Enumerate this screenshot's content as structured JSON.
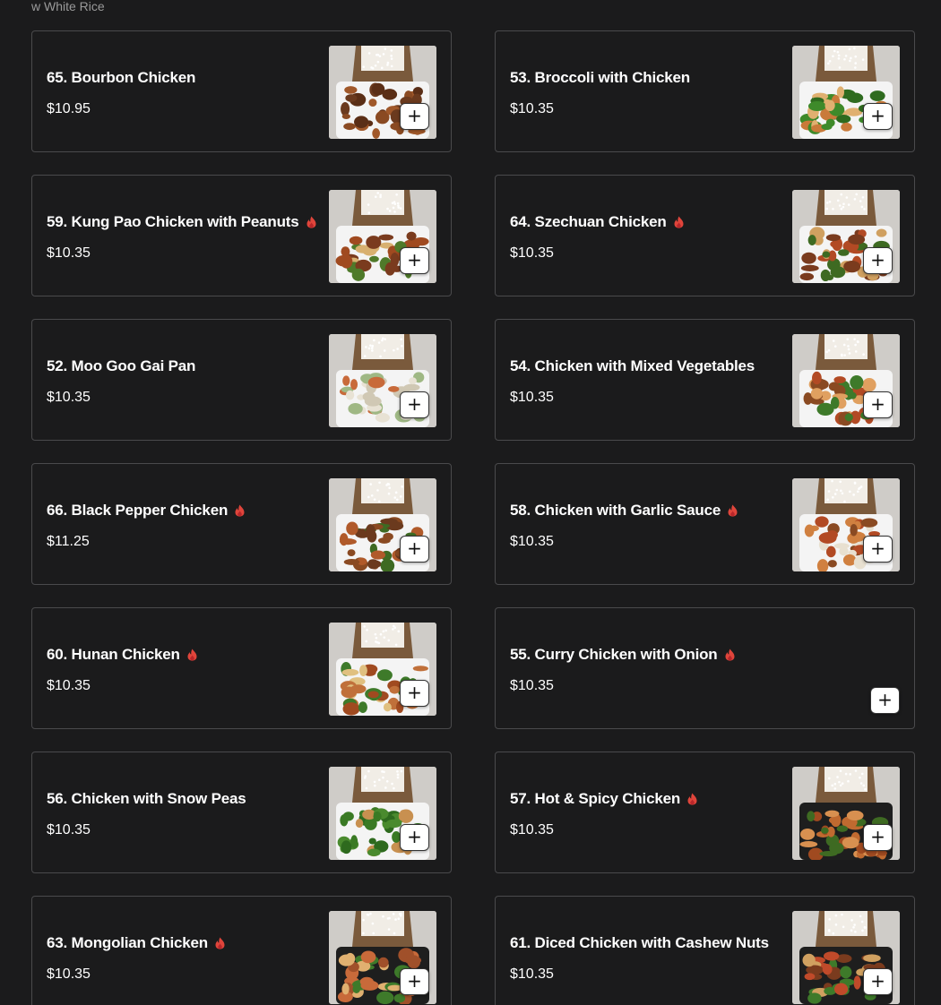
{
  "section_note": "w White Rice",
  "colors": {
    "background": "#1b1b1c",
    "card_border": "#4a4a4c",
    "spicy": "#e0453b"
  },
  "add_button_label": "+",
  "items": [
    {
      "name": "65. Bourbon Chicken",
      "price": "$10.95",
      "spicy": false,
      "photo": true,
      "dish": "bourbon"
    },
    {
      "name": "53. Broccoli with Chicken",
      "price": "$10.35",
      "spicy": false,
      "photo": true,
      "dish": "broccoli"
    },
    {
      "name": "59. Kung Pao Chicken with Peanuts",
      "price": "$10.35",
      "spicy": true,
      "photo": true,
      "dish": "kungpao"
    },
    {
      "name": "64. Szechuan Chicken",
      "price": "$10.35",
      "spicy": true,
      "photo": true,
      "dish": "szechuan"
    },
    {
      "name": "52. Moo Goo Gai Pan",
      "price": "$10.35",
      "spicy": false,
      "photo": true,
      "dish": "moogoo"
    },
    {
      "name": "54. Chicken with Mixed Vegetables",
      "price": "$10.35",
      "spicy": false,
      "photo": true,
      "dish": "mixedveg"
    },
    {
      "name": "66. Black Pepper Chicken",
      "price": "$11.25",
      "spicy": true,
      "photo": true,
      "dish": "blackpepper"
    },
    {
      "name": "58. Chicken with Garlic Sauce",
      "price": "$10.35",
      "spicy": true,
      "photo": true,
      "dish": "garlic"
    },
    {
      "name": "60. Hunan Chicken",
      "price": "$10.35",
      "spicy": true,
      "photo": true,
      "dish": "hunan"
    },
    {
      "name": "55. Curry Chicken with Onion",
      "price": "$10.35",
      "spicy": true,
      "photo": false,
      "dish": ""
    },
    {
      "name": "56. Chicken with Snow Peas",
      "price": "$10.35",
      "spicy": false,
      "photo": true,
      "dish": "snowpeas"
    },
    {
      "name": "57. Hot & Spicy Chicken",
      "price": "$10.35",
      "spicy": true,
      "photo": true,
      "dish": "hotspicy"
    },
    {
      "name": "63. Mongolian Chicken",
      "price": "$10.35",
      "spicy": true,
      "photo": true,
      "dish": "mongolian"
    },
    {
      "name": "61. Diced Chicken with Cashew Nuts",
      "price": "$10.35",
      "spicy": false,
      "photo": true,
      "dish": "cashew"
    }
  ]
}
